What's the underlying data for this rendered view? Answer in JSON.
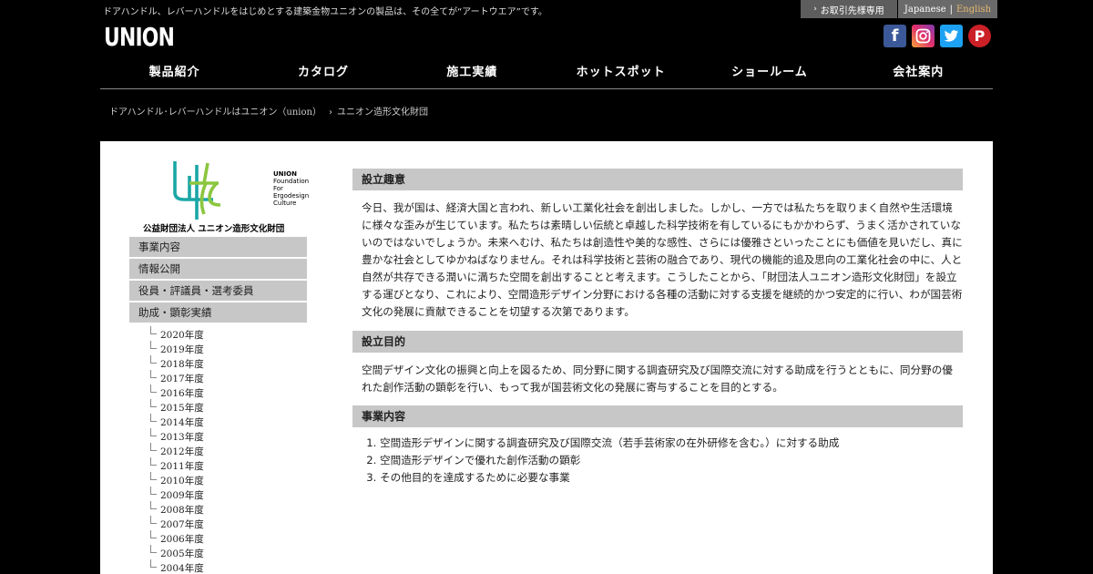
{
  "header": {
    "tagline": "ドアハンドル、レバーハンドルをはじめとする建築金物ユニオンの製品は、その全てが“アートウエア”です。",
    "logo": "UNION",
    "dealer_link": "お取引先様専用",
    "lang_ja": "Japanese",
    "lang_sep": "|",
    "lang_en": "English",
    "social": [
      {
        "icon": "facebook-icon",
        "glyph": "f"
      },
      {
        "icon": "instagram-icon",
        "glyph": ""
      },
      {
        "icon": "twitter-icon",
        "glyph": ""
      },
      {
        "icon": "pinterest-icon",
        "glyph": "P"
      }
    ]
  },
  "gnav": [
    "製品紹介",
    "カタログ",
    "施工実績",
    "ホットスポット",
    "ショールーム",
    "会社案内"
  ],
  "breadcrumb": {
    "home": "ドアハンドル･レバーハンドルはユニオン（union）",
    "current": "ユニオン造形文化財団"
  },
  "org": {
    "en_lines": [
      "UNION",
      "Foundation",
      "For",
      "Ergodesign",
      "Culture"
    ],
    "name": "公益財団法人 ユニオン造形文化財団",
    "colors": {
      "teal": "#1aa6a6",
      "lime": "#8cc63f"
    }
  },
  "sidebar": {
    "items": [
      "事業内容",
      "情報公開",
      "役員・評議員・選考委員",
      "助成・顕彰実績"
    ],
    "years": [
      "2020年度",
      "2019年度",
      "2018年度",
      "2017年度",
      "2016年度",
      "2015年度",
      "2014年度",
      "2013年度",
      "2012年度",
      "2011年度",
      "2010年度",
      "2009年度",
      "2008年度",
      "2007年度",
      "2006年度",
      "2005年度",
      "2004年度"
    ]
  },
  "sections": [
    {
      "title": "設立趣意",
      "body": "今日、我が国は、経済大国と言われ、新しい工業化社会を創出しました。しかし、一方では私たちを取りまく自然や生活環境に様々な歪みが生じています。私たちは素晴しい伝統と卓越した科学技術を有しているにもかかわらず、うまく活かされていないのではないでしょうか。未来へむけ、私たちは創造性や美的な感性、さらには優雅さといったことにも価値を見いだし、真に豊かな社会としてゆかねばなりません。それは科学技術と芸術の融合であり、現代の機能的追及思向の工業化社会の中に、人と自然が共存できる潤いに満ちた空間を創出することと考えます。こうしたことから、「財団法人ユニオン造形文化財団」を設立する運びとなり、これにより、空間造形デザイン分野における各種の活動に対する支援を継続的かつ安定的に行い、わが国芸術文化の発展に貢献できることを切望する次第であります。"
    },
    {
      "title": "設立目的",
      "body": "空間デザイン文化の振興と向上を図るため、同分野に関する調査研究及び国際交流に対する助成を行うとともに、同分野の優れた創作活動の顕彰を行い、もって我が国芸術文化の発展に寄与することを目的とする。"
    },
    {
      "title": "事業内容",
      "items": [
        "空間造形デザインに関する調査研究及び国際交流（若手芸術家の在外研修を含む。）に対する助成",
        "空間造形デザインで優れた創作活動の顕彰",
        "その他目的を達成するために必要な事業"
      ]
    }
  ]
}
